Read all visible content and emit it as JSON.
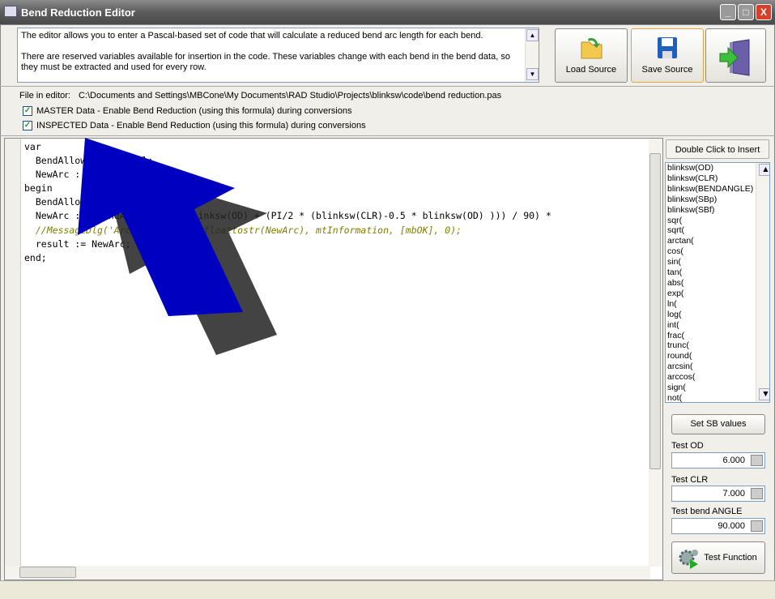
{
  "window": {
    "title": "Bend Reduction Editor"
  },
  "description": {
    "line1": "The editor allows you to enter a Pascal-based set of code that will calculate a reduced bend arc length for each bend.",
    "line2": "There are reserved variables available for insertion in the code.  These variables change with each bend in the bend data, so they must be extracted and used for every row."
  },
  "toolbar": {
    "load": "Load Source",
    "save": "Save Source"
  },
  "file": {
    "label": "File in editor:",
    "path": "C:\\Documents and Settings\\MBCone\\My Documents\\RAD Studio\\Projects\\blinksw\\code\\bend reduction.pas"
  },
  "options": {
    "master": "MASTER Data - Enable Bend Reduction (using this formula) during conversions",
    "inspected": "INSPECTED Data - Enable Bend Reduction (using this formula) during conversions",
    "master_checked": true,
    "inspected_checked": true
  },
  "code": {
    "lines": [
      "var",
      "  BendAllowance : real;",
      "  NewArc : real;",
      "begin",
      "  BendAllowance := 1.64;",
      "  NewArc := (BendAllowance * blinksw(OD) + (PI/2 * (blinksw(CLR)-0.5 * blinksw(OD) ))) / 90) *",
      "  //MessageDlg('Arc Length: ' + floattostr(NewArc), mtInformation, [mbOK], 0);",
      "  result := NewArc;",
      "end;"
    ]
  },
  "insert": {
    "header": "Double Click to Insert",
    "items": [
      "blinksw(OD)",
      "blinksw(CLR)",
      "blinksw(BENDANGLE)",
      "blinksw(SBp)",
      "blinksw(SBf)",
      "sqr(",
      "sqrt(",
      "arctan(",
      "cos(",
      "sin(",
      "tan(",
      "abs(",
      "exp(",
      "ln(",
      "log(",
      "int(",
      "frac(",
      "trunc(",
      "round(",
      "arcsin(",
      "arccos(",
      "sign(",
      "not("
    ]
  },
  "test": {
    "set_sb": "Set SB values",
    "od_label": "Test OD",
    "od": "6.000",
    "clr_label": "Test CLR",
    "clr": "7.000",
    "angle_label": "Test bend ANGLE",
    "angle": "90.000",
    "run": "Test Function"
  },
  "colors": {
    "arrow": "#0000c0"
  }
}
